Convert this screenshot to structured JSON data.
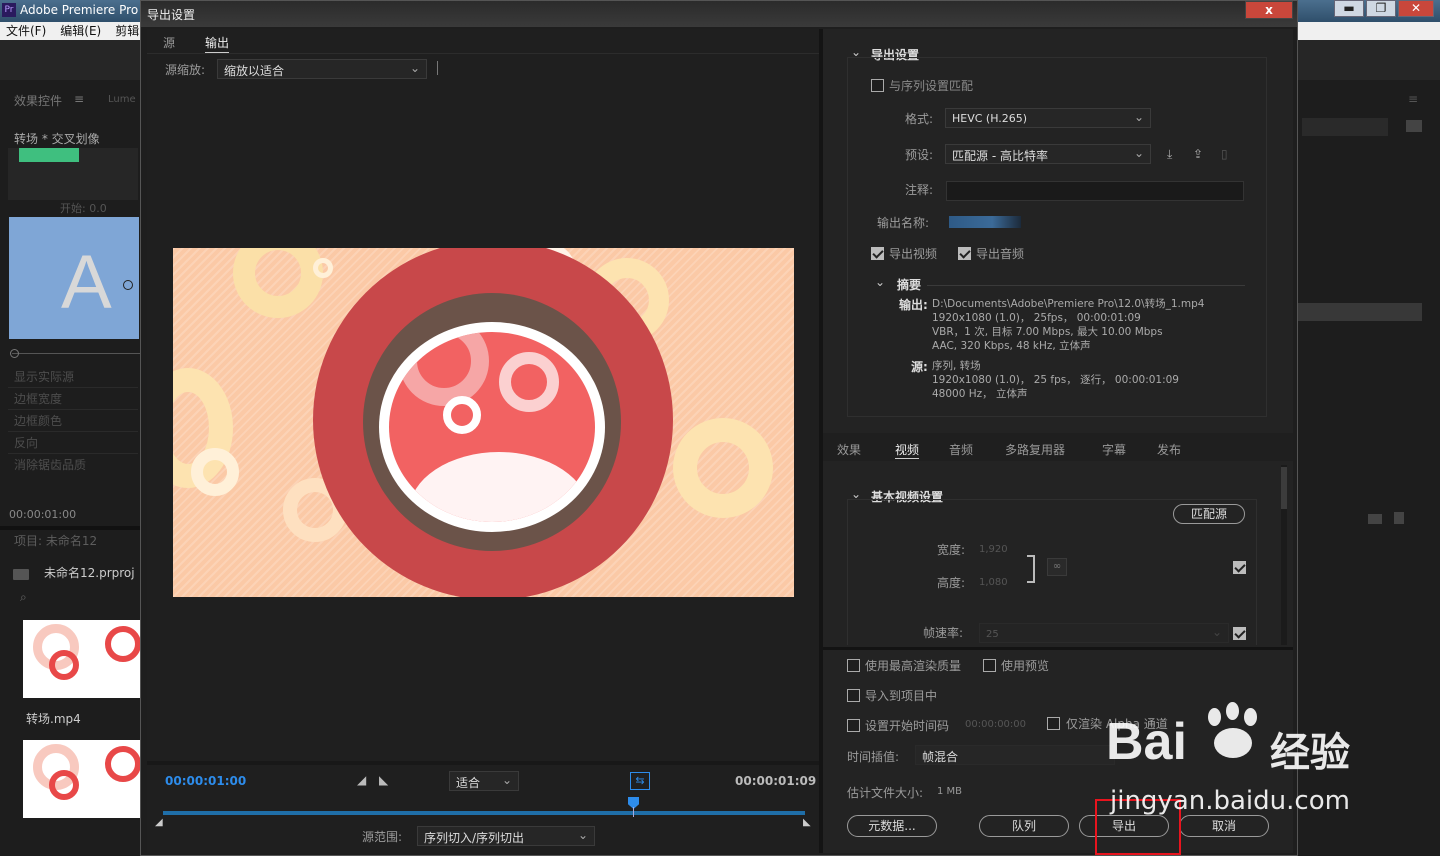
{
  "app": {
    "title": "Adobe Premiere Pro",
    "menus": [
      "文件(F)",
      "编辑(E)",
      "剪辑"
    ]
  },
  "left": {
    "panel_tab": "效果控件",
    "lumetri_tab": "Lume",
    "clip_label": "转场 * 交叉划像",
    "start_label": "开始: 0.0",
    "a_letter": "A",
    "props": [
      "显示实际源",
      "边框宽度",
      "边框颜色",
      "反向",
      "消除锯齿品质"
    ],
    "timecode": "00:00:01:00",
    "project_title": "项目: 未命名12",
    "project_file": "未命名12.prproj",
    "thumb1_label": "转场.mp4"
  },
  "dialog": {
    "title": "导出设置",
    "close": "x",
    "tabs": [
      "源",
      "输出"
    ],
    "scale_label": "源缩放:",
    "scale_value": "缩放以适合",
    "tc_start": "00:00:01:00",
    "tc_end": "00:00:01:09",
    "fit_value": "适合",
    "range_label": "源范围:",
    "range_value": "序列切入/序列切出"
  },
  "settings": {
    "section_title": "导出设置",
    "match_seq": "与序列设置匹配",
    "format_label": "格式:",
    "format_value": "HEVC (H.265)",
    "preset_label": "预设:",
    "preset_value": "匹配源 - 高比特率",
    "comment_label": "注释:",
    "output_name_label": "输出名称:",
    "export_video": "导出视频",
    "export_audio": "导出音频",
    "summary_title": "摘要",
    "output_label": "输出:",
    "output_lines": [
      "D:\\Documents\\Adobe\\Premiere Pro\\12.0\\转场_1.mp4",
      "1920x1080 (1.0)， 25fps， 00:00:01:09",
      "VBR，1 次, 目标 7.00 Mbps, 最大 10.00 Mbps",
      "AAC, 320 Kbps, 48 kHz, 立体声"
    ],
    "source_label": "源:",
    "source_lines": [
      "序列, 转场",
      "1920x1080 (1.0)， 25 fps， 逐行， 00:00:01:09",
      "48000 Hz， 立体声"
    ],
    "tabs": [
      "效果",
      "视频",
      "音频",
      "多路复用器",
      "字幕",
      "发布"
    ],
    "basic_title": "基本视频设置",
    "match_source_btn": "匹配源",
    "width_label": "宽度:",
    "width_value": "1,920",
    "height_label": "高度:",
    "height_value": "1,080",
    "fps_label": "帧速率:",
    "fps_value": "25",
    "max_quality": "使用最高渲染质量",
    "use_preview": "使用预览",
    "import_project": "导入到项目中",
    "set_start_tc": "设置开始时间码",
    "start_tc_value": "00:00:00:00",
    "alpha_only": "仅渲染 Alpha 通道",
    "interp_label": "时间插值:",
    "interp_value": "帧混合",
    "filesize_label": "估计文件大小:",
    "filesize_value": "1 MB",
    "btn_metadata": "元数据...",
    "btn_queue": "队列",
    "btn_export": "导出",
    "btn_cancel": "取消"
  },
  "watermark": {
    "logo_text": "Bai",
    "logo_cn": "经验",
    "url": "jingyan.baidu.com"
  },
  "colors": {
    "accent": "#2d8ceb",
    "timeline": "#1f6ea8",
    "highlight": "#e8141e"
  }
}
